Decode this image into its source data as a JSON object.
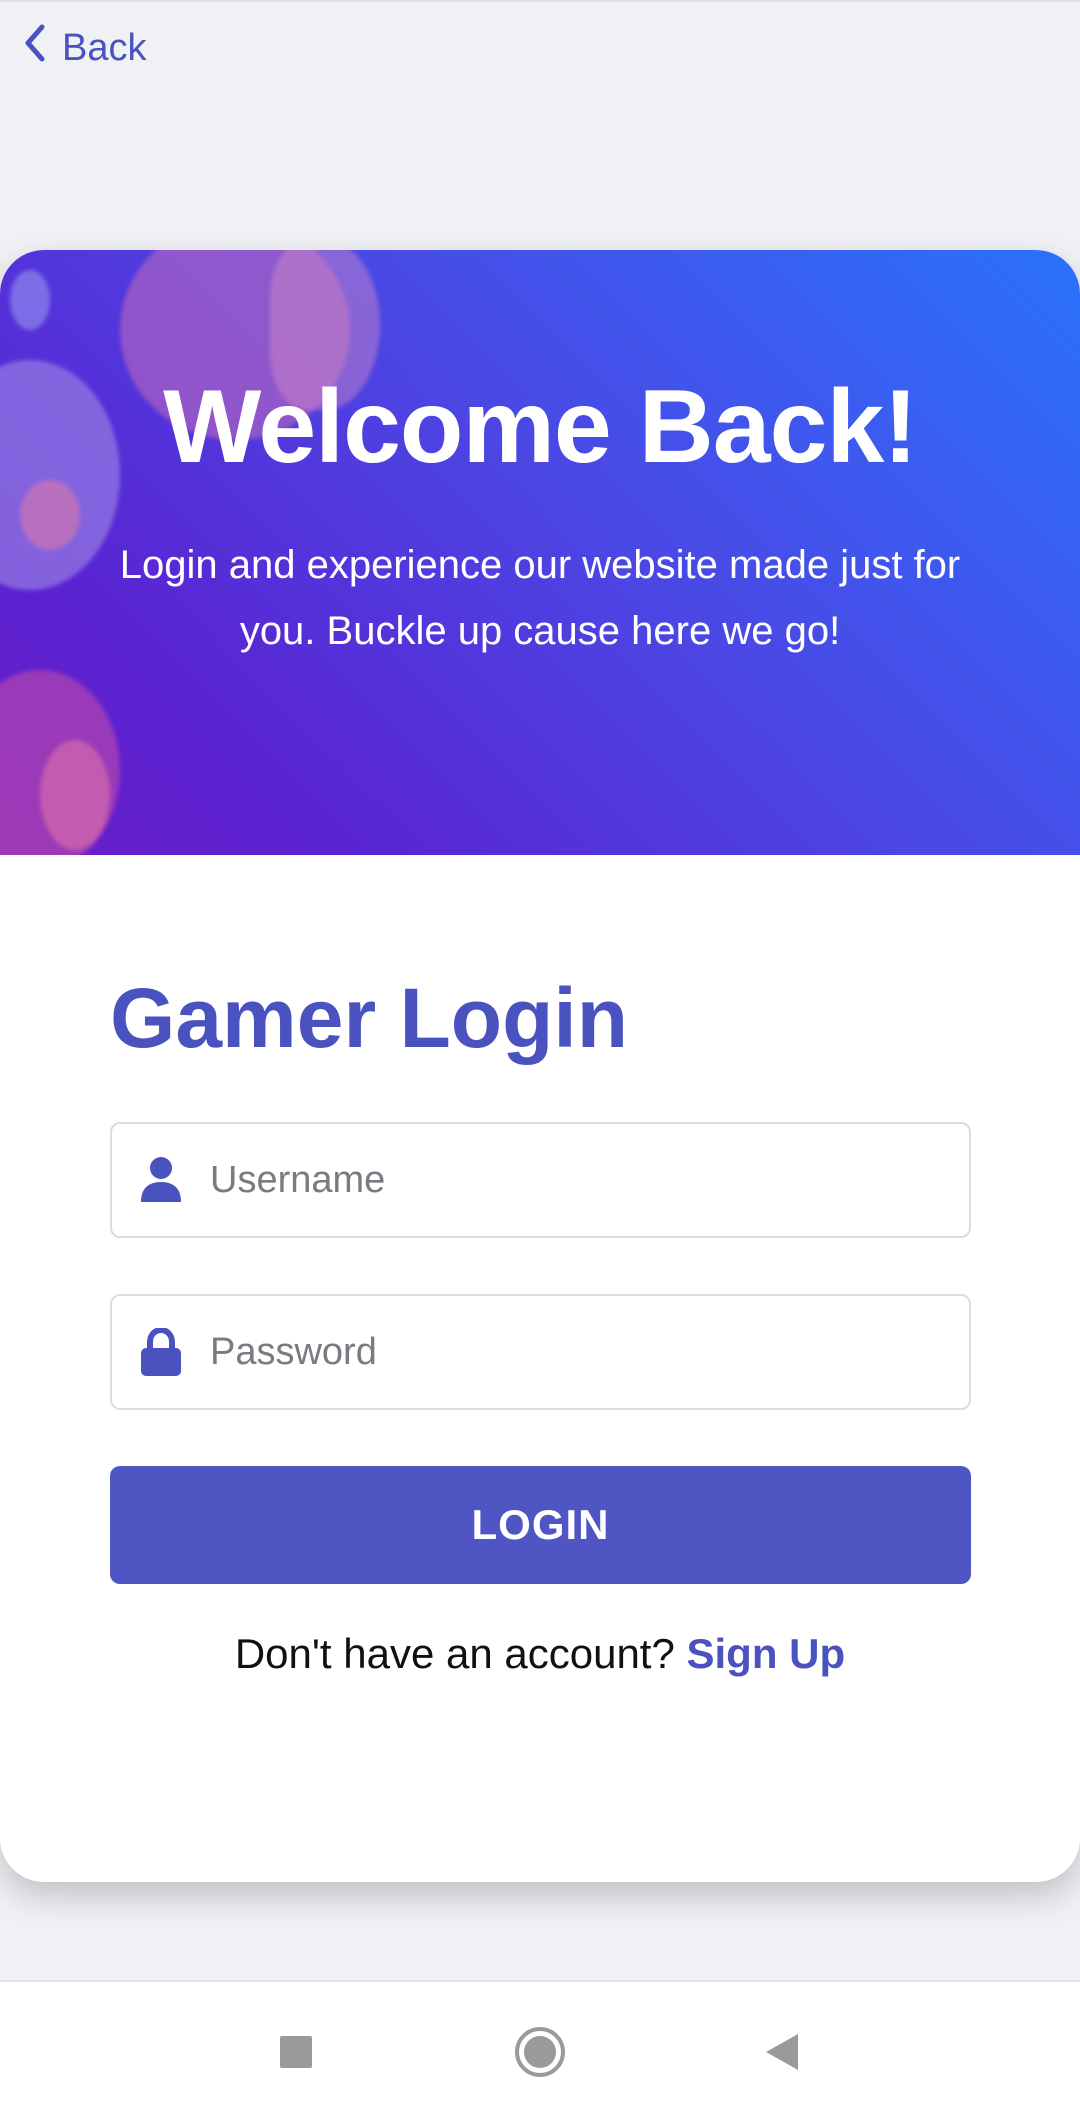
{
  "nav": {
    "back_label": "Back"
  },
  "hero": {
    "title": "Welcome Back!",
    "subtitle": "Login and experience our website made just for you. Buckle up cause here we go!"
  },
  "form": {
    "title": "Gamer Login",
    "username_placeholder": "Username",
    "password_placeholder": "Password",
    "login_label": "LOGIN",
    "signup_prompt": "Don't have an account?",
    "signup_link": "Sign Up"
  },
  "colors": {
    "accent": "#4a52c0",
    "button": "#5055c4",
    "hero_gradient_start": "#2a72fb",
    "hero_gradient_end": "#6a1cc6"
  },
  "icons": {
    "back": "chevron-left-icon",
    "username": "user-icon",
    "password": "lock-icon",
    "system_recent": "square-icon",
    "system_home": "circle-icon",
    "system_back": "triangle-left-icon"
  }
}
